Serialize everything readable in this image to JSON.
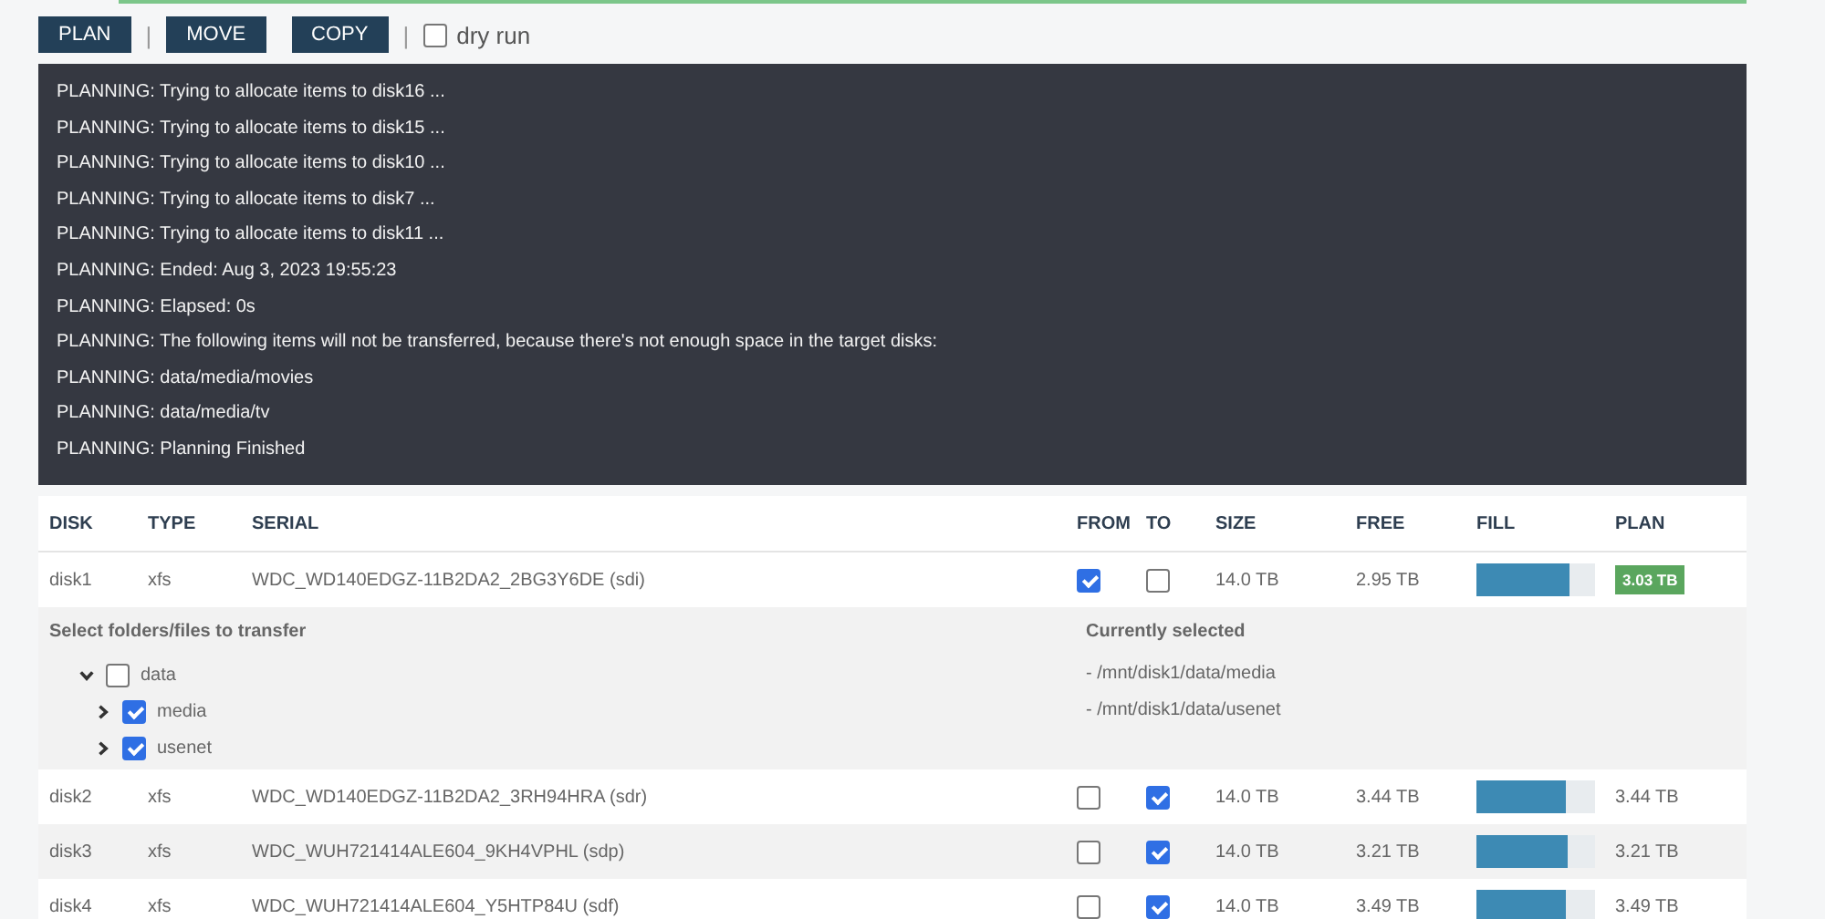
{
  "toolbar": {
    "buttons": [
      "PLAN",
      "MOVE",
      "COPY"
    ],
    "separator": "|",
    "dry_run": {
      "label": "dry run",
      "checked": false
    }
  },
  "console": {
    "lines": [
      "PLANNING: Trying to allocate items to disk16 ...",
      "PLANNING: Trying to allocate items to disk15 ...",
      "PLANNING: Trying to allocate items to disk10 ...",
      "PLANNING: Trying to allocate items to disk7 ...",
      "PLANNING: Trying to allocate items to disk11 ...",
      "PLANNING: Ended: Aug 3, 2023 19:55:23",
      "PLANNING: Elapsed: 0s",
      "PLANNING: The following items will not be transferred, because there's not enough space in the target disks:",
      "PLANNING: data/media/movies",
      "PLANNING: data/media/tv",
      "PLANNING: Planning Finished"
    ]
  },
  "table": {
    "columns": [
      "DISK",
      "TYPE",
      "SERIAL",
      "FROM",
      "TO",
      "SIZE",
      "FREE",
      "FILL",
      "PLAN"
    ],
    "rows": [
      {
        "disk": "disk1",
        "type": "xfs",
        "serial": "WDC_WD140EDGZ-11B2DA2_2BG3Y6DE (sdi)",
        "from": true,
        "to": false,
        "size": "14.0 TB",
        "free": "2.95 TB",
        "level": 0.78,
        "plan": "3.03 TB",
        "plan_highlighted": true,
        "details": {
          "tree_title": "Select folders/files to transfer",
          "tree": [
            {
              "label": "data",
              "checked": false,
              "expanded": true,
              "children": [
                {
                  "label": "media",
                  "checked": true,
                  "expanded": false
                },
                {
                  "label": "usenet",
                  "checked": true,
                  "expanded": false
                }
              ]
            }
          ],
          "selected_title": "Currently selected",
          "selected_paths": [
            "- /mnt/disk1/data/media",
            "- /mnt/disk1/data/usenet"
          ]
        }
      },
      {
        "disk": "disk2",
        "type": "xfs",
        "serial": "WDC_WD140EDGZ-11B2DA2_3RH94HRA (sdr)",
        "from": false,
        "to": true,
        "size": "14.0 TB",
        "free": "3.44 TB",
        "level": 0.75,
        "plan": "3.44 TB",
        "plan_highlighted": false
      },
      {
        "disk": "disk3",
        "type": "xfs",
        "serial": "WDC_WUH721414ALE604_9KH4VPHL (sdp)",
        "from": false,
        "to": true,
        "size": "14.0 TB",
        "free": "3.21 TB",
        "level": 0.77,
        "plan": "3.21 TB",
        "plan_highlighted": false
      },
      {
        "disk": "disk4",
        "type": "xfs",
        "serial": "WDC_WUH721414ALE604_Y5HTP84U (sdf)",
        "from": false,
        "to": true,
        "size": "14.0 TB",
        "free": "3.49 TB",
        "level": 0.75,
        "plan": "3.49 TB",
        "plan_highlighted": false
      }
    ]
  }
}
